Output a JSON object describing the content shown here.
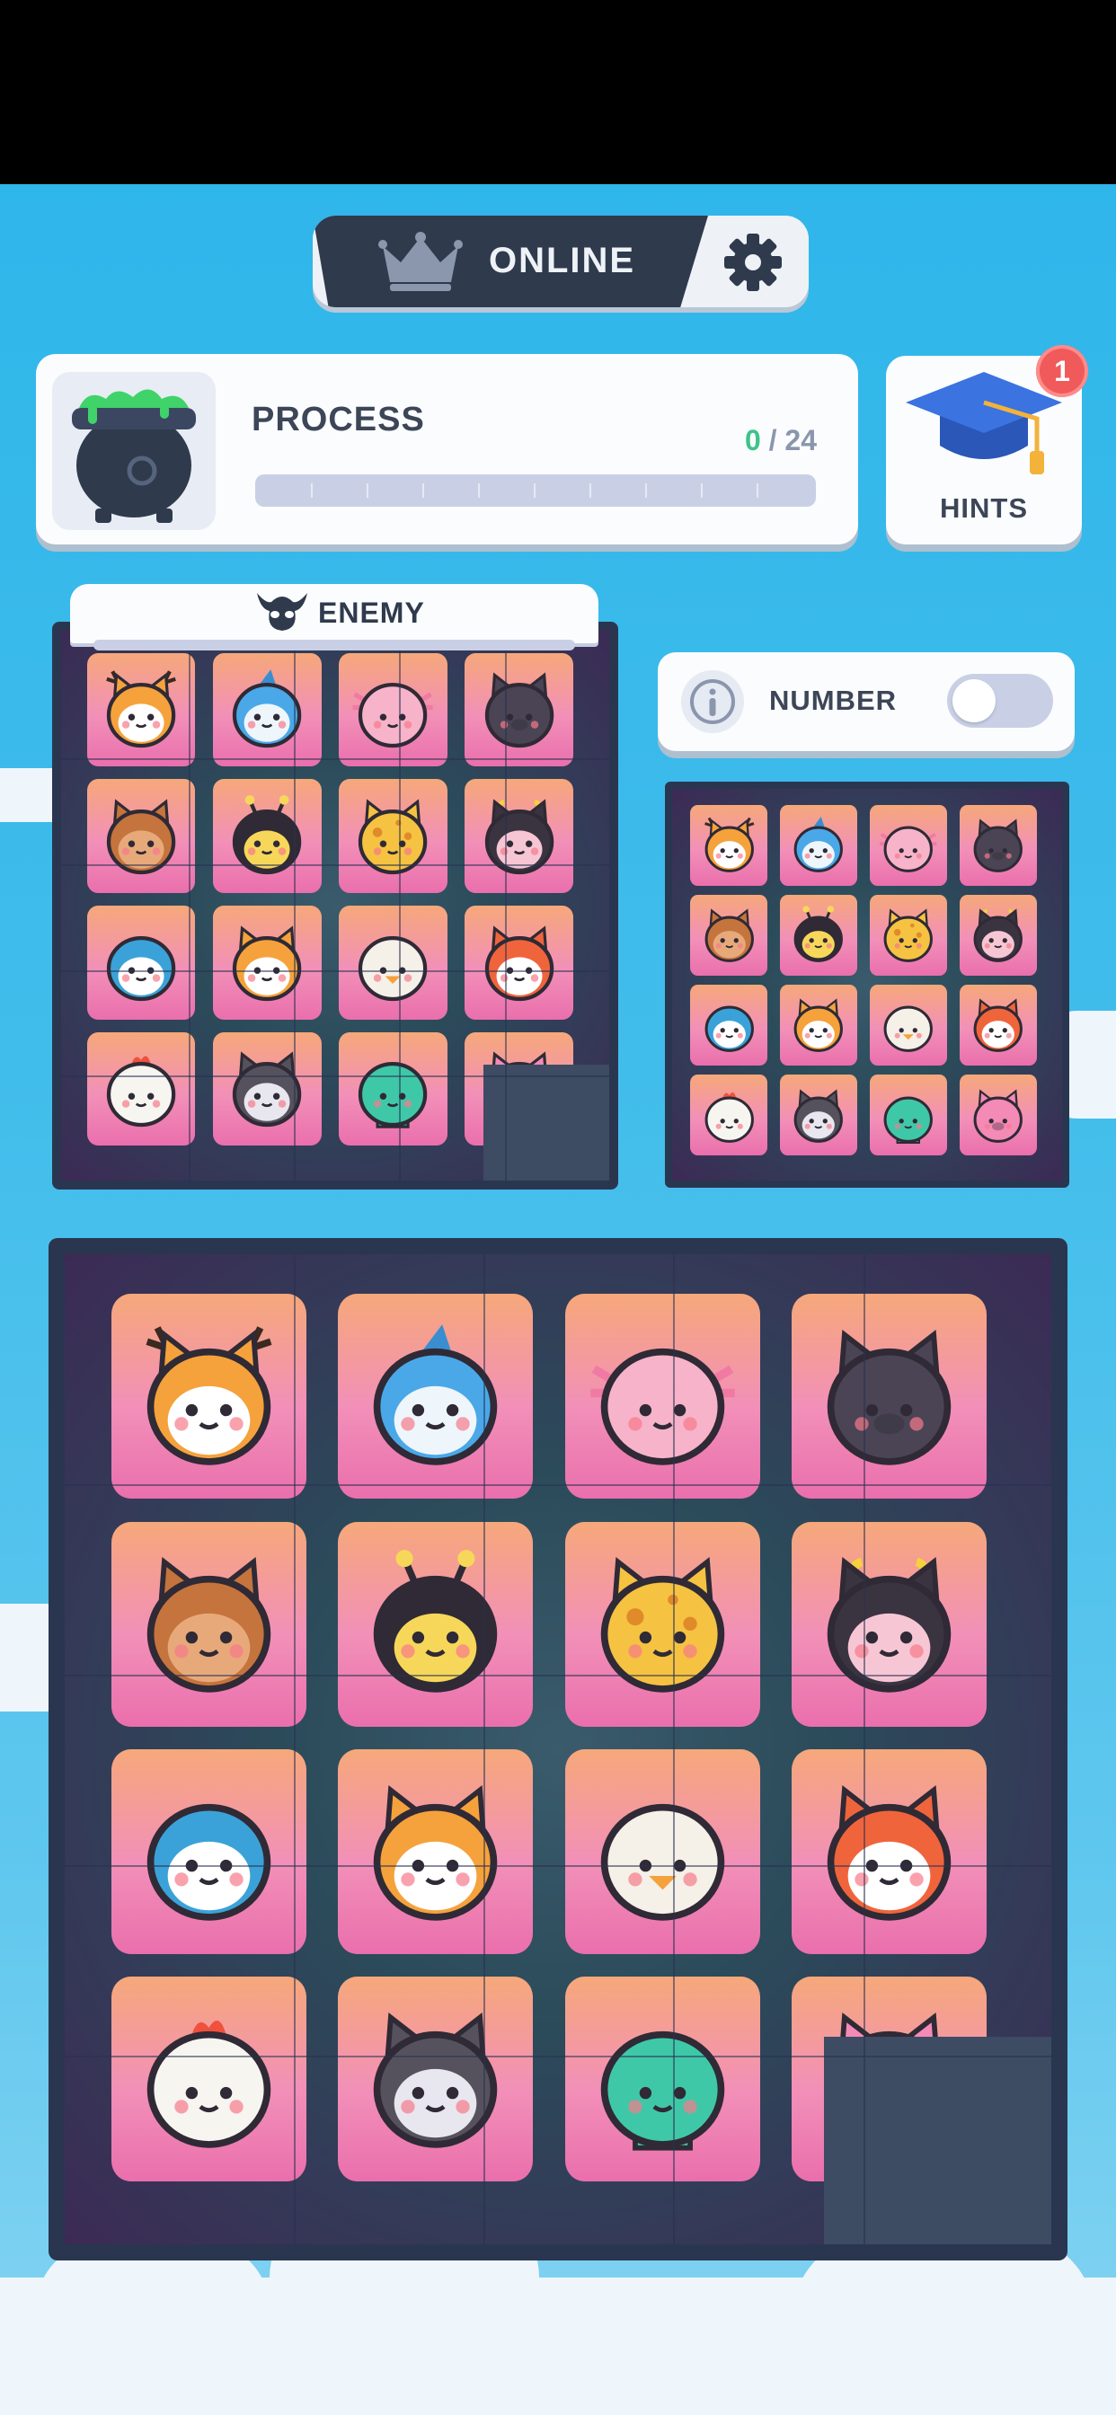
{
  "header": {
    "mode_label": "ONLINE"
  },
  "process": {
    "title": "PROCESS",
    "current": "0",
    "separator": " / ",
    "total": "24",
    "progress": 0
  },
  "hints": {
    "label": "HINTS",
    "badge": "1"
  },
  "enemy": {
    "label": "ENEMY"
  },
  "number_toggle": {
    "label": "NUMBER",
    "enabled": false
  },
  "icons": {
    "mode": "crown-icon",
    "settings": "gear-icon",
    "process": "cauldron-icon",
    "hints": "graduation-cap-icon",
    "enemy": "demon-icon",
    "info": "info-icon"
  },
  "tiles": [
    "deer",
    "shark",
    "axolotl",
    "bat-pig",
    "bear",
    "bee",
    "giraffe",
    "cow",
    "penguin",
    "shiba",
    "chick",
    "fox",
    "chicken",
    "wolf",
    "turtle",
    "pig"
  ],
  "empty_tile": "bottom-right",
  "colors": {
    "accent_green": "#3fc38a",
    "badge_red": "#f05a5a",
    "board_dark": "#2a3650",
    "tile_pink": "#f290b8"
  }
}
